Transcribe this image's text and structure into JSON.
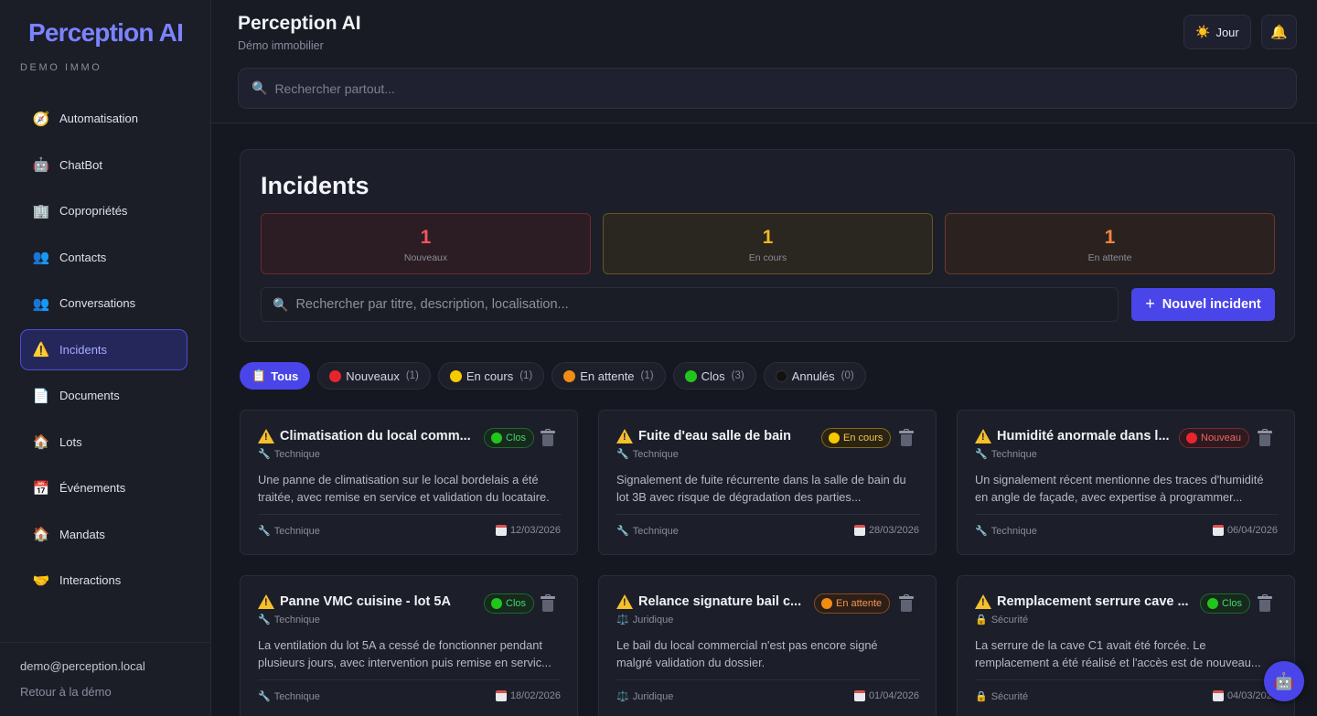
{
  "sidebar": {
    "logo": "Perception AI",
    "subtitle": "DEMO IMMO",
    "items": [
      {
        "label": "Automatisation",
        "icon": "🧭"
      },
      {
        "label": "ChatBot",
        "icon": "🤖"
      },
      {
        "label": "Copropriétés",
        "icon": "🏢"
      },
      {
        "label": "Contacts",
        "icon": "👥"
      },
      {
        "label": "Conversations",
        "icon": "👥"
      },
      {
        "label": "Incidents",
        "icon": "⚠️",
        "active": true
      },
      {
        "label": "Documents",
        "icon": "📄"
      },
      {
        "label": "Lots",
        "icon": "🏠"
      },
      {
        "label": "Événements",
        "icon": "📅"
      },
      {
        "label": "Mandats",
        "icon": "🏠"
      },
      {
        "label": "Interactions",
        "icon": "🤝"
      }
    ],
    "user_email": "demo@perception.local",
    "back_link": "Retour à la démo"
  },
  "header": {
    "title": "Perception AI",
    "subtitle": "Démo immobilier",
    "theme_label": "Jour",
    "theme_icon": "☀️",
    "bell_icon": "🔔",
    "search_placeholder": "Rechercher partout...",
    "search_icon": "🔍"
  },
  "incidents": {
    "title": "Incidents",
    "stats": [
      {
        "value": "1",
        "label": "Nouveaux",
        "color": "#f2555e"
      },
      {
        "value": "1",
        "label": "En cours",
        "color": "#f5b623"
      },
      {
        "value": "1",
        "label": "En attente",
        "color": "#f7853d"
      }
    ],
    "search_placeholder": "Rechercher par titre, description, localisation...",
    "new_button": "Nouvel incident",
    "filters": [
      {
        "label": "Tous",
        "icon": "📋",
        "count": "",
        "active": true
      },
      {
        "label": "Nouveaux",
        "dot": "#e8252f",
        "count": "(1)"
      },
      {
        "label": "En cours",
        "dot": "#f7c900",
        "count": "(1)"
      },
      {
        "label": "En attente",
        "dot": "#f28c13",
        "count": "(1)"
      },
      {
        "label": "Clos",
        "dot": "#22c51b",
        "count": "(3)"
      },
      {
        "label": "Annulés",
        "dot": "#111111",
        "count": "(0)"
      }
    ],
    "cards": [
      {
        "title": "Climatisation du local comm...",
        "status": "Clos",
        "status_class": "clos",
        "dot": "#22c51b",
        "category": "Technique",
        "category_icon": "🔧",
        "desc1": "Une panne de climatisation sur le local bordelais a été",
        "desc2": "traitée, avec remise en service et validation du locataire.",
        "date": "12/03/2026"
      },
      {
        "title": "Fuite d'eau salle de bain",
        "status": "En cours",
        "status_class": "encours",
        "dot": "#f7c900",
        "category": "Technique",
        "category_icon": "🔧",
        "desc1": "Signalement de fuite récurrente dans la salle de bain du",
        "desc2": "lot 3B avec risque de dégradation des parties...",
        "date": "28/03/2026"
      },
      {
        "title": "Humidité anormale dans l...",
        "status": "Nouveau",
        "status_class": "nouveau",
        "dot": "#e8252f",
        "category": "Technique",
        "category_icon": "🔧",
        "desc1": "Un signalement récent mentionne des traces d'humidité",
        "desc2": "en angle de façade, avec expertise à programmer...",
        "date": "06/04/2026"
      },
      {
        "title": "Panne VMC cuisine - lot 5A",
        "status": "Clos",
        "status_class": "clos",
        "dot": "#22c51b",
        "category": "Technique",
        "category_icon": "🔧",
        "desc1": "La ventilation du lot 5A a cessé de fonctionner pendant",
        "desc2": "plusieurs jours, avec intervention puis remise en servic...",
        "date": "18/02/2026"
      },
      {
        "title": "Relance signature bail c...",
        "status": "En attente",
        "status_class": "attente",
        "dot": "#f28c13",
        "category": "Juridique",
        "category_icon": "⚖️",
        "desc1": "Le bail du local commercial n'est pas encore signé",
        "desc2": "malgré validation du dossier.",
        "date": "01/04/2026"
      },
      {
        "title": "Remplacement serrure cave ...",
        "status": "Clos",
        "status_class": "clos",
        "dot": "#22c51b",
        "category": "Sécurité",
        "category_icon": "🔒",
        "desc1": "La serrure de la cave C1 avait été forcée. Le",
        "desc2": "remplacement a été réalisé et l'accès est de nouveau...",
        "date": "04/03/2026"
      }
    ]
  },
  "fab_icon": "🤖"
}
